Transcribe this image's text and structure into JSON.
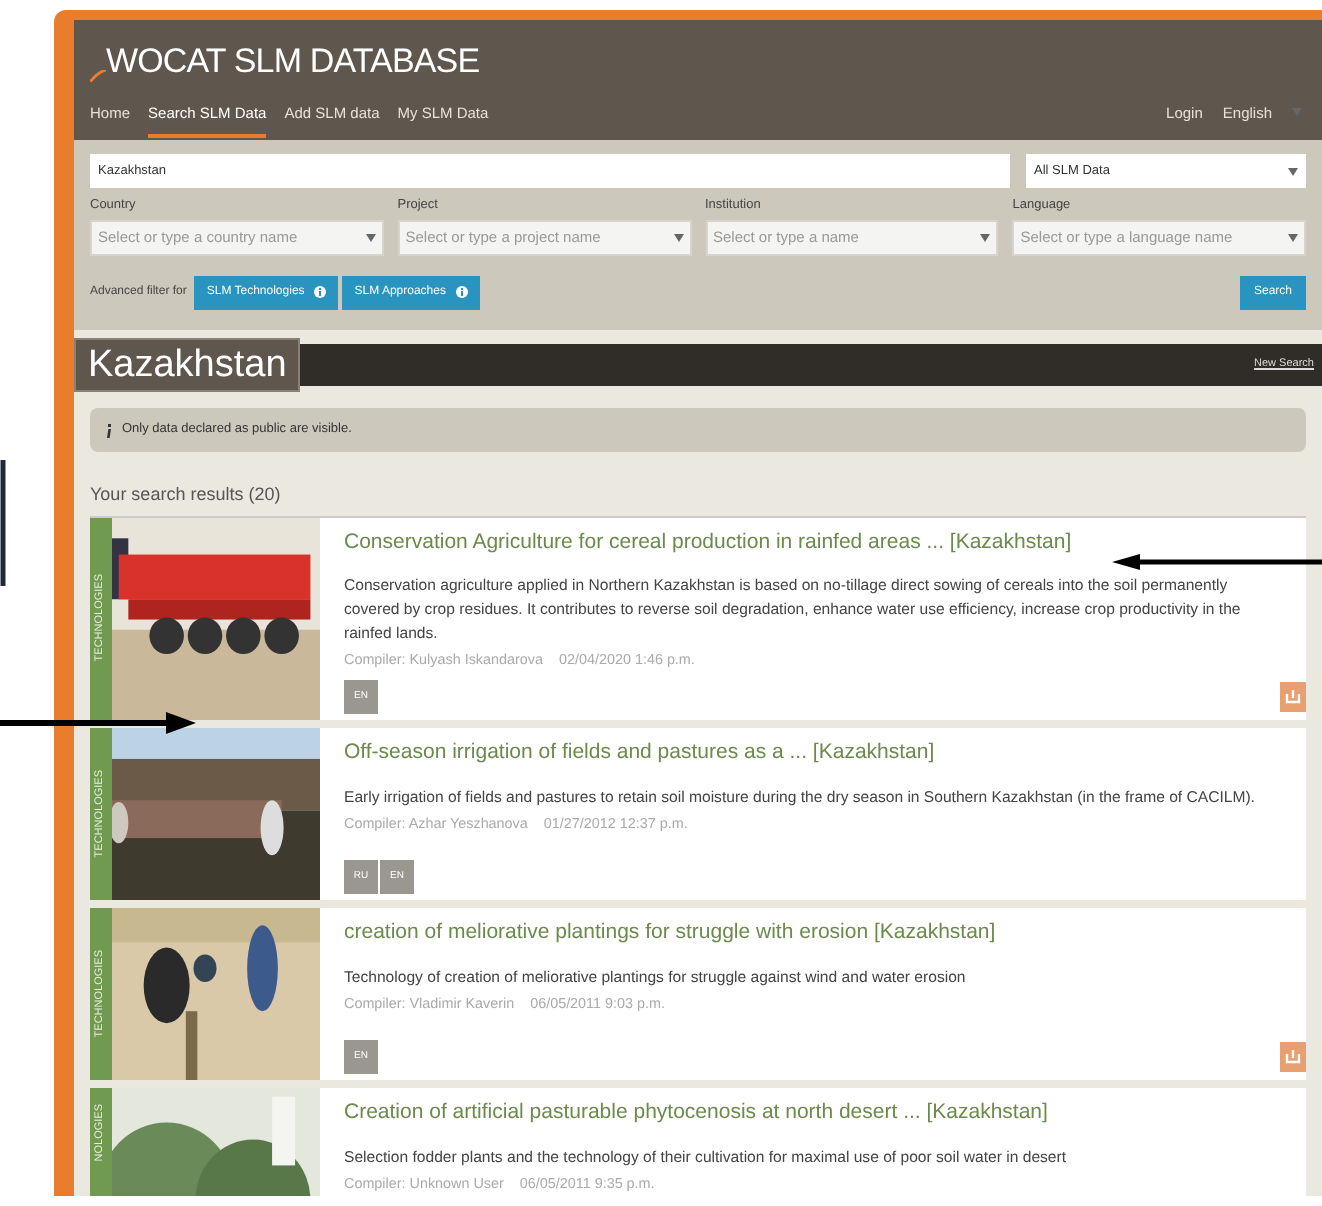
{
  "site": {
    "title": "WOCAT SLM DATABASE"
  },
  "nav": [
    {
      "label": "Home",
      "selected": false
    },
    {
      "label": "Search SLM Data",
      "selected": true
    },
    {
      "label": "Add SLM data",
      "selected": false
    },
    {
      "label": "My SLM Data",
      "selected": false
    }
  ],
  "nav_right": [
    "Login",
    "English"
  ],
  "search": {
    "value": "Kazakhstan",
    "scope": "All SLM Data"
  },
  "filters": [
    {
      "label": "Country",
      "placeholder": "Select or type a country name"
    },
    {
      "label": "Project",
      "placeholder": "Select or type a project name"
    },
    {
      "label": "Institution",
      "placeholder": "Select or type a name"
    },
    {
      "label": "Language",
      "placeholder": "Select or type a language name"
    }
  ],
  "advanced": {
    "label": "Advanced filter for",
    "buttons": [
      "SLM Technologies",
      "SLM Approaches"
    ],
    "search_button": "Search"
  },
  "heading": {
    "title": "Kazakhstan",
    "link": "New Search"
  },
  "notice": "Only data declared as public are visible.",
  "results_label": "Your search results (20)",
  "results": [
    {
      "category": "TECHNOLOGIES",
      "title": "Conservation Agriculture for cereal production in rainfed areas ... [Kazakhstan]",
      "description": "Conservation agriculture applied in Northern Kazakhstan is based on no-tillage direct sowing of cereals into the soil permanently covered by crop residues. It contributes to reverse soil degradation, enhance water use efficiency, increase crop productivity in the rainfed lands.",
      "compiler": "Compiler: Kulyash Iskandarova",
      "date": "02/04/2020 1:46 p.m.",
      "languages": [
        "EN"
      ],
      "export_badge": true,
      "kind": "machine"
    },
    {
      "category": "TECHNOLOGIES",
      "title": "Off-season irrigation of fields and pastures as a ... [Kazakhstan]",
      "description": "Early irrigation of fields and pastures to retain soil moisture during the dry season in Southern Kazakhstan (in the frame of CACILM).",
      "compiler": "Compiler: Azhar Yeszhanova",
      "date": "01/27/2012 12:37 p.m.",
      "languages": [
        "RU",
        "EN"
      ],
      "export_badge": false,
      "kind": "field"
    },
    {
      "category": "TECHNOLOGIES",
      "title": "creation of meliorative plantings for struggle with erosion [Kazakhstan]",
      "description": "Technology of creation of meliorative plantings for struggle against wind and water erosion",
      "compiler": "Compiler: Vladimir Kaverin",
      "date": "06/05/2011 9:03 p.m.",
      "languages": [
        "EN"
      ],
      "export_badge": true,
      "kind": "sand"
    },
    {
      "category": "NOLOGIES",
      "title": "Creation of artificial pasturable phytocenosis at north desert ... [Kazakhstan]",
      "description": "Selection fodder plants and the technology of their cultivation for maximal use of poor soil water in desert",
      "compiler": "Compiler: Unknown User",
      "date": "06/05/2011 9:35 p.m.",
      "export_badge": false,
      "kind": "plants"
    }
  ]
}
